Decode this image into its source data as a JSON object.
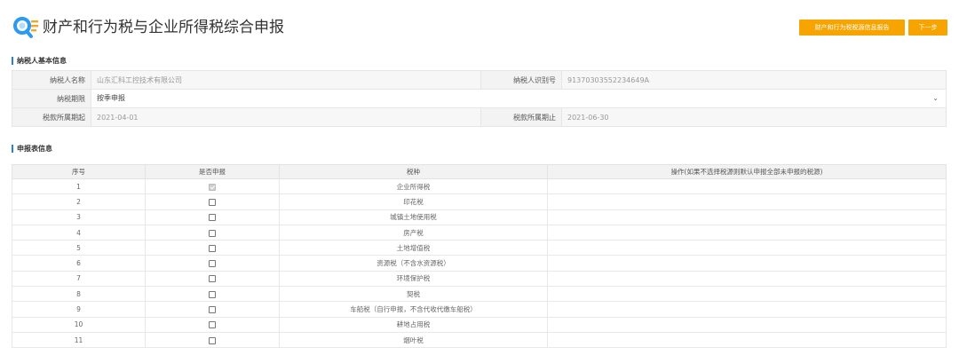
{
  "header": {
    "title": "财产和行为税与企业所得税综合申报",
    "report_button": "财产和行为税税源信息报告",
    "next_button": "下一步"
  },
  "taxpayer_section": {
    "title": "纳税人基本信息",
    "name_label": "纳税人名称",
    "name_value": "山东汇科工控技术有限公司",
    "id_label": "纳税人识别号",
    "id_value": "91370303552234649A",
    "period_label": "纳税期限",
    "period_value": "按季申报",
    "start_label": "税款所属期起",
    "start_value": "2021-04-01",
    "end_label": "税款所属期止",
    "end_value": "2021-06-30"
  },
  "declaration_section": {
    "title": "申报表信息",
    "columns": [
      "序号",
      "是否申报",
      "税种",
      "操作(如果不选择税源则默认申报全部未申报的税源)"
    ],
    "rows": [
      {
        "no": "1",
        "tax": "企业所得税",
        "checked": true
      },
      {
        "no": "2",
        "tax": "印花税",
        "checked": false
      },
      {
        "no": "3",
        "tax": "城镇土地使用税",
        "checked": false
      },
      {
        "no": "4",
        "tax": "房产税",
        "checked": false
      },
      {
        "no": "5",
        "tax": "土地增值税",
        "checked": false
      },
      {
        "no": "6",
        "tax": "资源税（不含水资源税）",
        "checked": false
      },
      {
        "no": "7",
        "tax": "环境保护税",
        "checked": false
      },
      {
        "no": "8",
        "tax": "契税",
        "checked": false
      },
      {
        "no": "9",
        "tax": "车船税（自行申报，不含代收代缴车船税）",
        "checked": false
      },
      {
        "no": "10",
        "tax": "耕地占用税",
        "checked": false
      },
      {
        "no": "11",
        "tax": "烟叶税",
        "checked": false
      }
    ]
  },
  "colors": {
    "accent_orange": "#f7a400",
    "section_bar_blue": "#2b7de1",
    "logo_blue": "#2b9af3",
    "logo_orange": "#f5a623"
  }
}
